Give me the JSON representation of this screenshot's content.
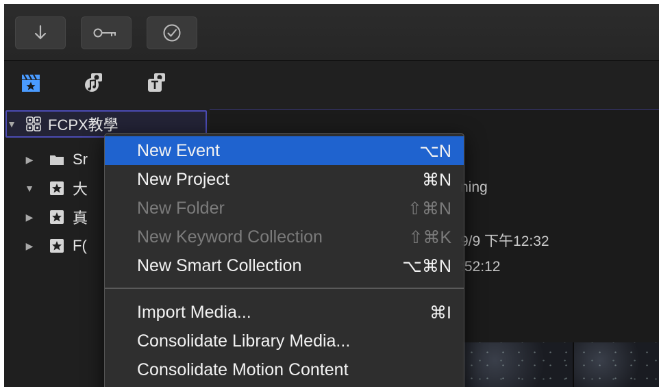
{
  "toolbar": {
    "buttons": [
      {
        "icon": "download-arrow-icon"
      },
      {
        "icon": "key-icon"
      },
      {
        "icon": "checkmark-circle-icon"
      }
    ]
  },
  "tabs": [
    {
      "icon": "clapper-star-icon",
      "accent": "#4a9bff"
    },
    {
      "icon": "camera-music-icon"
    },
    {
      "icon": "camera-title-icon"
    }
  ],
  "sidebar": {
    "library": {
      "name": "FCPX教學"
    },
    "items": [
      {
        "name": "Sr"
      },
      {
        "name": "大"
      },
      {
        "name": "真"
      },
      {
        "name": "F("
      }
    ]
  },
  "content": {
    "line1": "ning",
    "line2": "9/9 下午12:32",
    "line3": ":52:12"
  },
  "menu": {
    "items": [
      {
        "label": "New Event",
        "shortcut": "⌥N",
        "state": "highlighted"
      },
      {
        "label": "New Project",
        "shortcut": "⌘N",
        "state": "enabled"
      },
      {
        "label": "New Folder",
        "shortcut": "⇧⌘N",
        "state": "disabled"
      },
      {
        "label": "New Keyword Collection",
        "shortcut": "⇧⌘K",
        "state": "disabled"
      },
      {
        "label": "New Smart Collection",
        "shortcut": "⌥⌘N",
        "state": "enabled"
      },
      {
        "label": "Import Media...",
        "shortcut": "⌘I",
        "state": "enabled"
      },
      {
        "label": "Consolidate Library Media...",
        "shortcut": "",
        "state": "enabled"
      },
      {
        "label": "Consolidate Motion Content",
        "shortcut": "",
        "state": "enabled"
      }
    ]
  },
  "colors": {
    "highlight": "#1f63cf",
    "selection_border": "#4b4bb4"
  }
}
